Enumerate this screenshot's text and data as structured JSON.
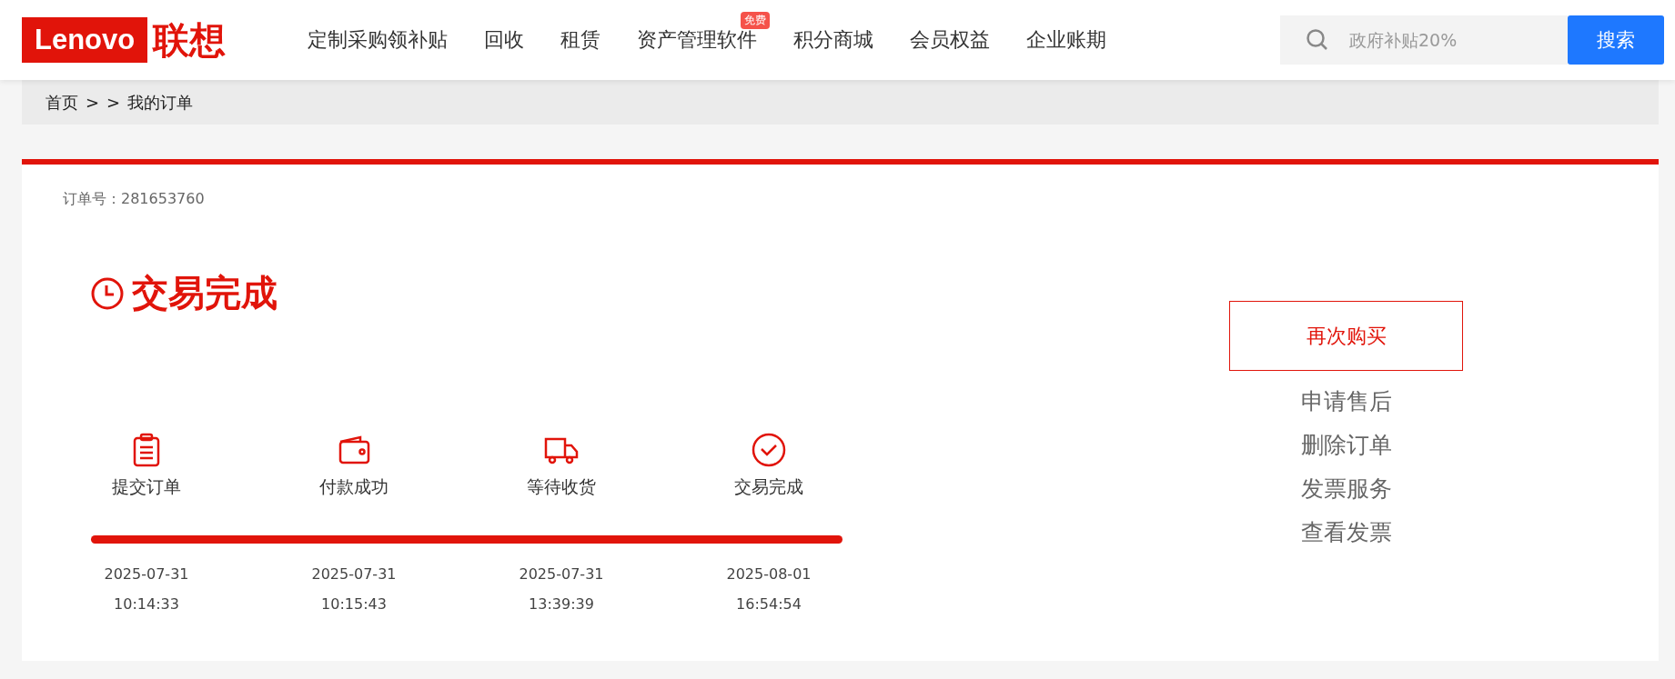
{
  "header": {
    "logo": {
      "latin": "Lenovo",
      "chinese": "联想"
    },
    "nav": [
      {
        "label": "定制采购领补贴"
      },
      {
        "label": "回收"
      },
      {
        "label": "租赁"
      },
      {
        "label": "资产管理软件",
        "badge": "免费"
      },
      {
        "label": "积分商城"
      },
      {
        "label": "会员权益"
      },
      {
        "label": "企业账期"
      }
    ],
    "search": {
      "placeholder": "政府补贴20%",
      "button": "搜索"
    }
  },
  "breadcrumb": [
    "首页",
    ">",
    ">",
    "我的订单"
  ],
  "order": {
    "number_label": "订单号：281653760",
    "status": "交易完成",
    "steps": [
      {
        "label": "提交订单",
        "date": "2025-07-31",
        "time": "10:14:33"
      },
      {
        "label": "付款成功",
        "date": "2025-07-31",
        "time": "10:15:43"
      },
      {
        "label": "等待收货",
        "date": "2025-07-31",
        "time": "13:39:39"
      },
      {
        "label": "交易完成",
        "date": "2025-08-01",
        "time": "16:54:54"
      }
    ],
    "progress": {
      "level": 1
    },
    "primary_action": "再次购买",
    "actions": [
      "申请售后",
      "删除订单",
      "发票服务",
      "查看发票"
    ]
  }
}
